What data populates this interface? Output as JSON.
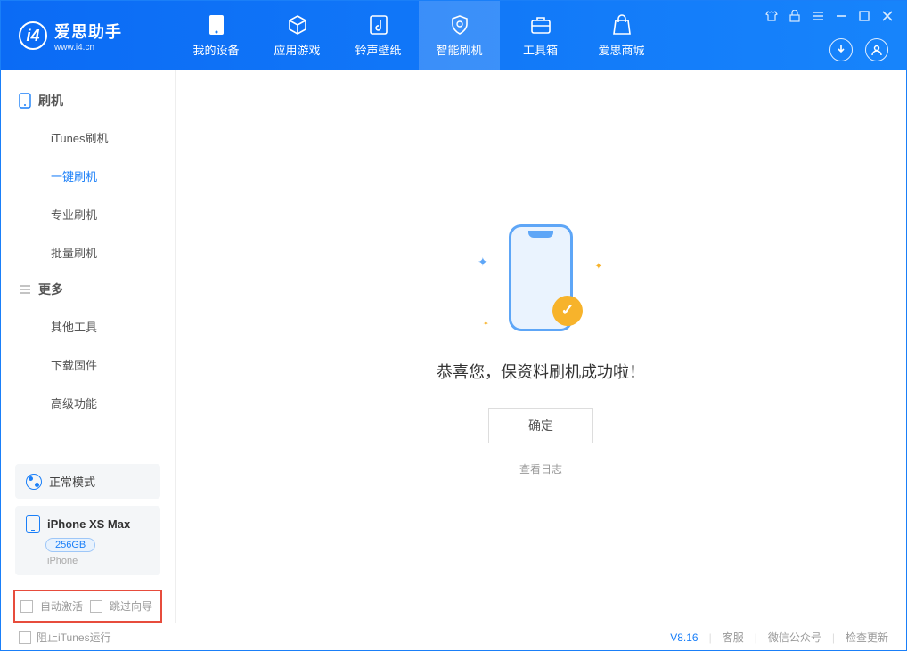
{
  "app": {
    "name": "爱思助手",
    "domain": "www.i4.cn"
  },
  "nav": {
    "tabs": [
      {
        "label": "我的设备"
      },
      {
        "label": "应用游戏"
      },
      {
        "label": "铃声壁纸"
      },
      {
        "label": "智能刷机"
      },
      {
        "label": "工具箱"
      },
      {
        "label": "爱思商城"
      }
    ]
  },
  "sidebar": {
    "group1_title": "刷机",
    "items1": [
      {
        "label": "iTunes刷机"
      },
      {
        "label": "一键刷机"
      },
      {
        "label": "专业刷机"
      },
      {
        "label": "批量刷机"
      }
    ],
    "group2_title": "更多",
    "items2": [
      {
        "label": "其他工具"
      },
      {
        "label": "下载固件"
      },
      {
        "label": "高级功能"
      }
    ]
  },
  "status": {
    "mode": "正常模式"
  },
  "device": {
    "name": "iPhone XS Max",
    "storage": "256GB",
    "type": "iPhone"
  },
  "options": {
    "auto_activate": "自动激活",
    "skip_guide": "跳过向导"
  },
  "main": {
    "success_msg": "恭喜您，保资料刷机成功啦！",
    "confirm": "确定",
    "view_log": "查看日志"
  },
  "footer": {
    "block_itunes": "阻止iTunes运行",
    "version": "V8.16",
    "links": [
      "客服",
      "微信公众号",
      "检查更新"
    ]
  }
}
